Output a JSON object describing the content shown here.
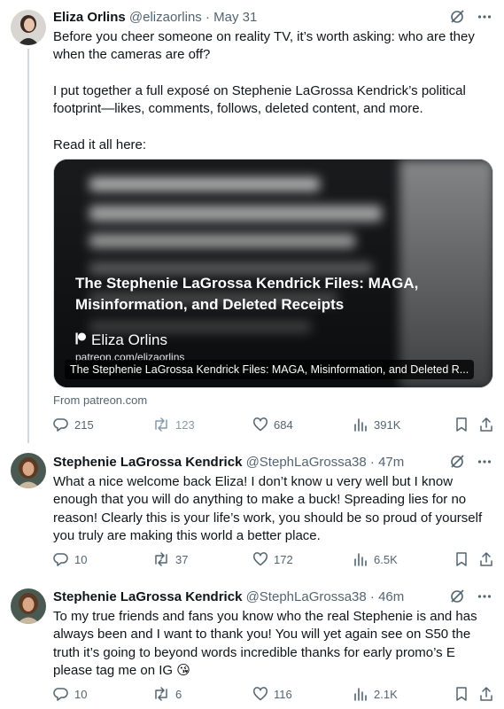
{
  "tweets": [
    {
      "author_name": "Eliza Orlins",
      "handle": "@elizaorlins",
      "separator": "·",
      "time": "May 31",
      "text": "Before you cheer someone on reality TV, it’s worth asking: who are they when the cameras are off?\n\nI put together a full exposé on Stephenie LaGrossa Kendrick’s political footprint—likes, comments, follows, deleted content, and more.\n\nRead it all here:",
      "card": {
        "title": "The Stephenie LaGrossa Kendrick Files: MAGA, Misinformation, and Deleted Receipts",
        "brand": "Eliza Orlins",
        "url": "patreon.com/elizaorlins",
        "caption": "The Stephenie LaGrossa Kendrick Files: MAGA, Misinformation, and Deleted R...",
        "source": "From patreon.com"
      },
      "replies": "215",
      "reposts": "123",
      "likes": "684",
      "views": "391K"
    },
    {
      "author_name": "Stephenie LaGrossa Kendrick",
      "handle": "@StephLaGrossa38",
      "separator": "·",
      "time": "47m",
      "text": "What a nice welcome back Eliza! I don’t know u very well but I know enough that you will do anything to make a buck! Spreading lies for no reason! Clearly this is your life’s work, you should be so proud of yourself you truly are making this world a better place.",
      "replies": "10",
      "reposts": "37",
      "likes": "172",
      "views": "6.5K"
    },
    {
      "author_name": "Stephenie LaGrossa Kendrick",
      "handle": "@StephLaGrossa38",
      "separator": "·",
      "time": "46m",
      "text": "To my true friends and fans you know who the real Stephenie is and has always been and I want to thank you! You will yet again see on S50 the truth it’s going to beyond words incredible thanks for early promo’s E please tag me on IG 😘",
      "replies": "10",
      "reposts": "6",
      "likes": "116",
      "views": "2.1K"
    }
  ],
  "icons": {
    "grok": "grok-icon",
    "more": "more-icon",
    "reply": "reply-icon",
    "repost": "repost-icon",
    "like": "heart-icon",
    "views": "views-icon",
    "bookmark": "bookmark-icon",
    "share": "share-icon",
    "patreon": "patreon-icon"
  },
  "colors": {
    "text": "#0f1419",
    "secondary": "#536471",
    "thread_line": "#cfd9de"
  }
}
